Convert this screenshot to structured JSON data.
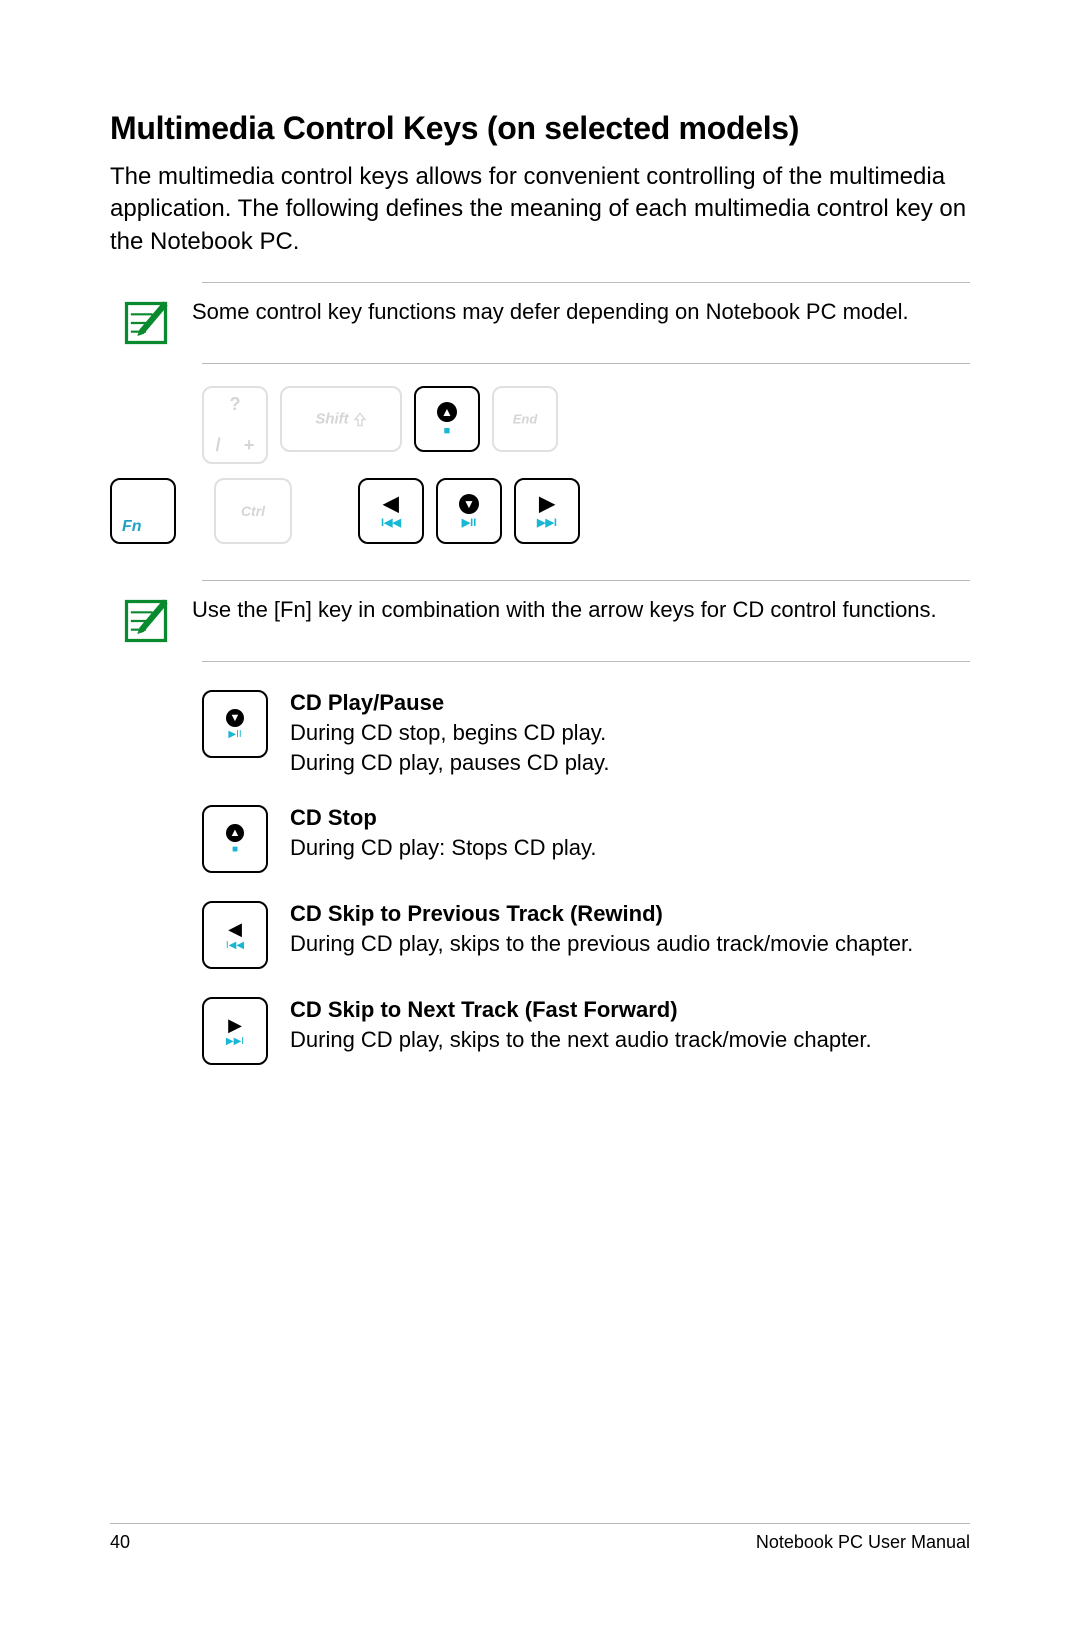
{
  "title": "Multimedia Control Keys (on selected models)",
  "intro": "The multimedia control keys allows for convenient controlling of the multimedia application. The following defines the meaning of each multimedia control key on the Notebook PC.",
  "note1": "Some control key functions may defer depending on Notebook PC model.",
  "note2": "Use the [Fn] key in combination with the arrow keys for CD control functions.",
  "keys": {
    "slash_top": "?",
    "slash_bot_left": "/",
    "slash_bot_right": "+",
    "shift": "Shift",
    "end": "End",
    "fn": "Fn",
    "ctrl": "Ctrl"
  },
  "media": {
    "stop": "■",
    "play_pause": "▶II",
    "prev": "I◀◀",
    "next": "▶▶I",
    "arrow_up": "▲",
    "arrow_down": "▼",
    "arrow_left": "◀",
    "arrow_right": "▶"
  },
  "functions": [
    {
      "title": "CD Play/Pause",
      "body": "During CD stop, begins CD play.\nDuring CD play, pauses CD play.",
      "icon": "down_play"
    },
    {
      "title": "CD Stop",
      "body": "During CD play: Stops CD play.",
      "icon": "up_stop"
    },
    {
      "title": "CD Skip to Previous Track (Rewind)",
      "body": "During CD play, skips to the previous audio track/movie chapter.",
      "icon": "left_prev"
    },
    {
      "title": "CD Skip to Next Track (Fast Forward)",
      "body": "During CD play, skips to the next audio track/movie chapter.",
      "icon": "right_next"
    }
  ],
  "footer": {
    "page": "40",
    "manual": "Notebook PC User Manual"
  }
}
